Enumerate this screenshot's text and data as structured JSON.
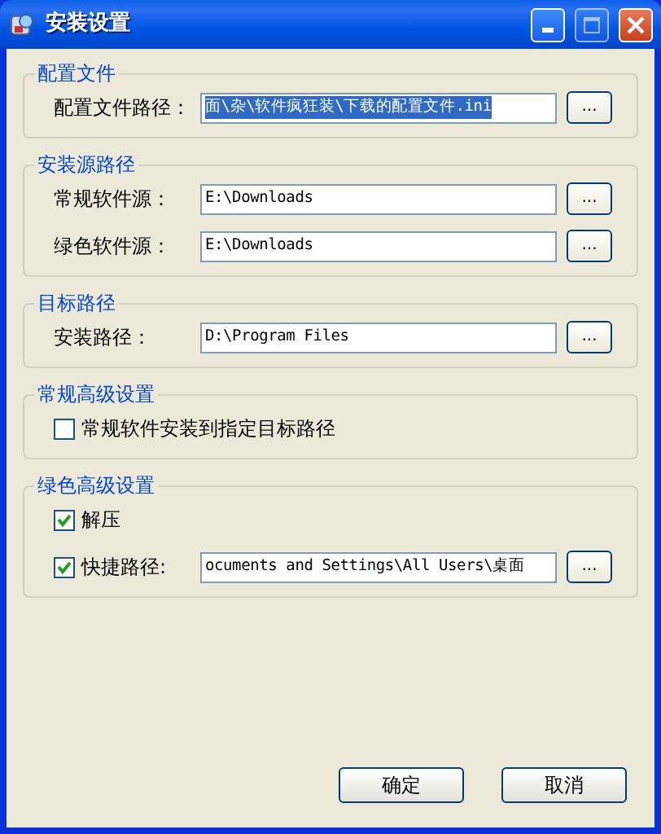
{
  "window": {
    "title": "安装设置"
  },
  "groups": [
    {
      "title": "配置文件",
      "rows": [
        {
          "kind": "path",
          "label": "配置文件路径：",
          "value": "面\\杂\\软件疯狂装\\下载的配置文件.ini",
          "selected": true,
          "button": "..."
        }
      ]
    },
    {
      "title": "安装源路径",
      "rows": [
        {
          "kind": "path",
          "label": "常规软件源：",
          "value": "E:\\Downloads",
          "selected": false,
          "button": "..."
        },
        {
          "kind": "path",
          "label": "绿色软件源：",
          "value": "E:\\Downloads",
          "selected": false,
          "button": "..."
        }
      ]
    },
    {
      "title": "目标路径",
      "rows": [
        {
          "kind": "path",
          "label": "安装路径：",
          "value": "D:\\Program Files",
          "selected": false,
          "button": "..."
        }
      ]
    },
    {
      "title": "常规高级设置",
      "rows": [
        {
          "kind": "checkbox",
          "label": "常规软件安装到指定目标路径",
          "checked": false
        }
      ]
    },
    {
      "title": "绿色高级设置",
      "rows": [
        {
          "kind": "checkbox",
          "label": "解压",
          "checked": true
        },
        {
          "kind": "checkpath",
          "label": "快捷路径:",
          "checked": true,
          "value": "ocuments and Settings\\All Users\\桌面",
          "selected": false,
          "button": "..."
        }
      ]
    }
  ],
  "buttons": [
    "确定",
    "取消"
  ]
}
